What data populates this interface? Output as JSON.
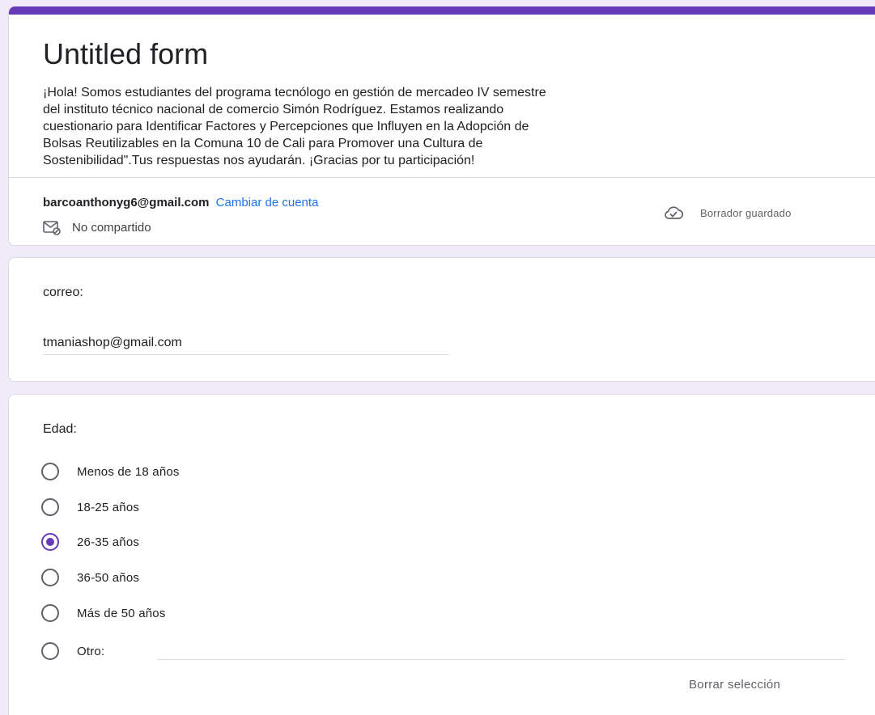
{
  "header": {
    "title": "Untitled form",
    "description": "¡Hola! Somos estudiantes del programa tecnólogo en gestión de mercadeo IV semestre\ndel instituto técnico nacional de comercio Simón Rodríguez. Estamos realizando\ncuestionario para Identificar Factores y Percepciones que Influyen en la Adopción de\nBolsas Reutilizables en la Comuna 10 de Cali para Promover una Cultura de\nSostenibilidad\".Tus respuestas nos ayudarán. ¡Gracias por tu participación!",
    "account_email": "barcoanthonyg6@gmail.com",
    "switch_account_label": "Cambiar de cuenta",
    "not_shared_label": "No compartido",
    "draft_saved_label": "Borrador guardado",
    "accent_color": "#673ab7"
  },
  "email_question": {
    "label": "correo:",
    "value": "tmaniashop@gmail.com"
  },
  "age_question": {
    "label": "Edad:",
    "options": [
      {
        "label": "Menos de 18 años",
        "selected": false
      },
      {
        "label": "18-25 años",
        "selected": false
      },
      {
        "label": "26-35 años",
        "selected": true
      },
      {
        "label": "36-50 años",
        "selected": false
      },
      {
        "label": "Más de 50 años",
        "selected": false
      },
      {
        "label": "Otro:",
        "selected": false
      }
    ],
    "clear_selection_label": "Borrar selección"
  }
}
